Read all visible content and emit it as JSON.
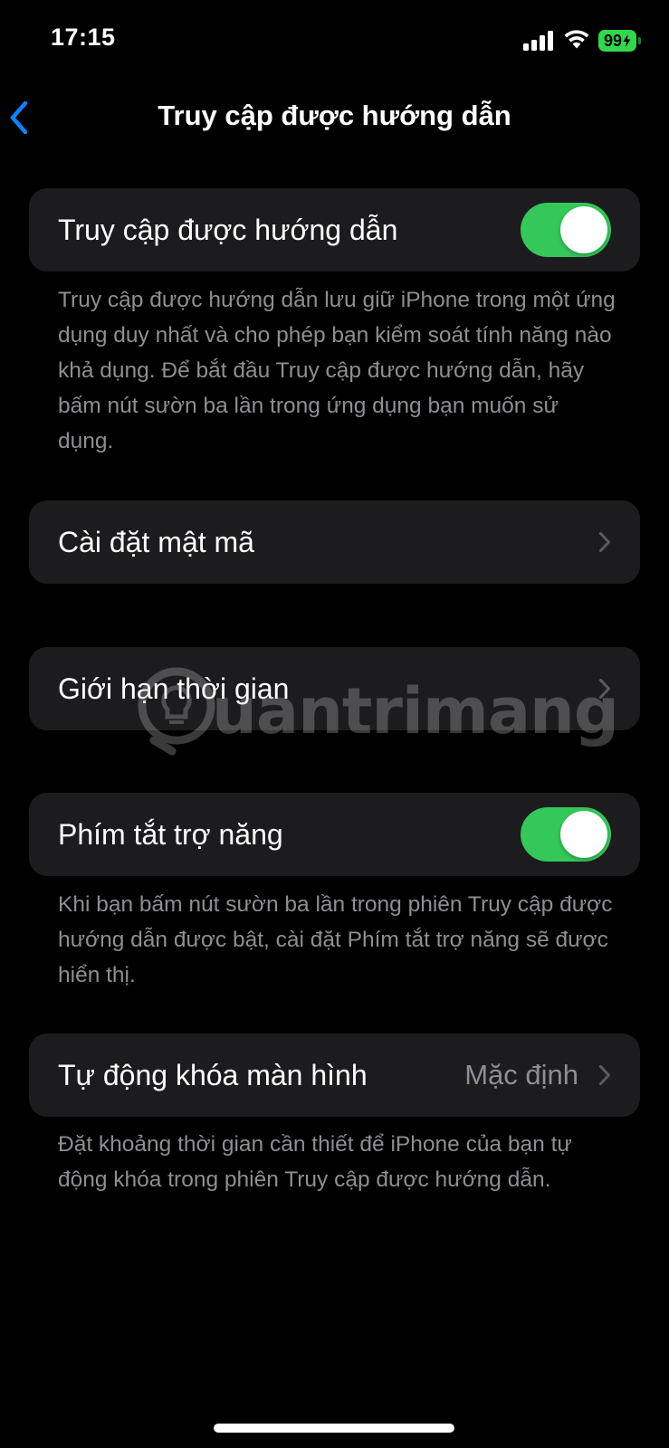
{
  "status_bar": {
    "time": "17:15",
    "battery_level": "99",
    "battery_charging": true,
    "signal_bars": 4,
    "wifi": true
  },
  "nav": {
    "back_icon": "chevron-left-icon",
    "title": "Truy cập được hướng dẫn"
  },
  "sections": {
    "guided_access": {
      "label": "Truy cập được hướng dẫn",
      "enabled": true,
      "footer": "Truy cập được hướng dẫn lưu giữ iPhone trong một ứng dụng duy nhất và cho phép bạn kiểm soát tính năng nào khả dụng. Để bắt đầu Truy cập được hướng dẫn, hãy bấm nút sườn ba lần trong ứng dụng bạn muốn sử dụng."
    },
    "passcode": {
      "label": "Cài đặt mật mã"
    },
    "time_limits": {
      "label": "Giới hạn thời gian"
    },
    "accessibility_shortcut": {
      "label": "Phím tắt trợ năng",
      "enabled": true,
      "footer": "Khi bạn bấm nút sườn ba lần trong phiên Truy cập được hướng dẫn được bật, cài đặt Phím tắt trợ năng sẽ được hiển thị."
    },
    "auto_lock": {
      "label": "Tự động khóa màn hình",
      "value": "Mặc định",
      "footer": "Đặt khoảng thời gian cần thiết để iPhone của bạn tự động khóa trong phiên Truy cập được hướng dẫn."
    }
  },
  "watermark": {
    "text": "uantrimang"
  },
  "colors": {
    "background": "#000000",
    "group_background": "#1c1c1e",
    "accent_blue": "#0a84ff",
    "toggle_on": "#34c759",
    "secondary_text": "#8e8e93",
    "battery_green": "#32d74b"
  }
}
